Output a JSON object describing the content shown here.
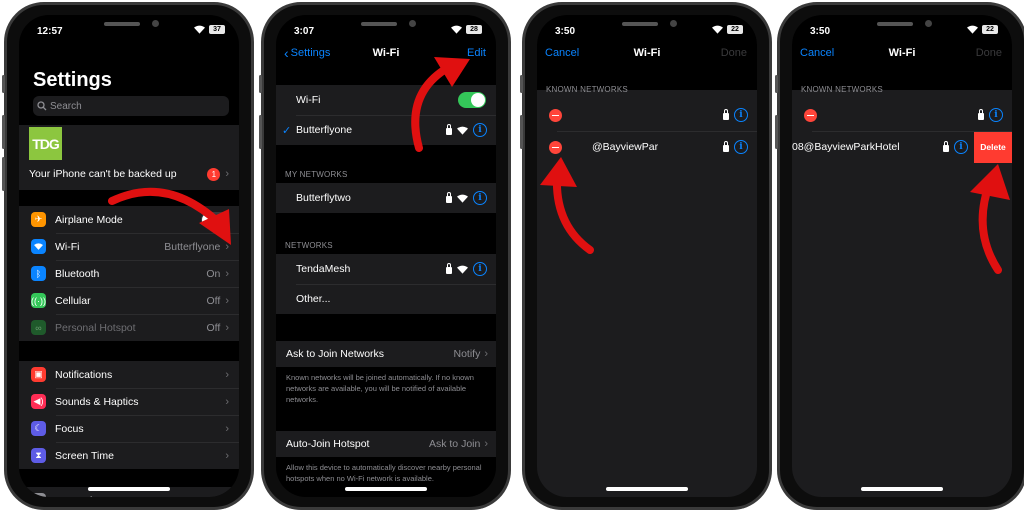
{
  "colors": {
    "accent": "#0a84ff",
    "destructive": "#ff3b30",
    "arrow": "#e01010",
    "toggle_on": "#34c759",
    "brand_tdg": "#8cc63f"
  },
  "phone1": {
    "status": {
      "time": "12:57",
      "battery": "37"
    },
    "title": "Settings",
    "search_placeholder": "Search",
    "profile_logo": "TDG",
    "backup_notice": {
      "label": "Your iPhone can't be backed up",
      "badge": "1"
    },
    "group1": [
      {
        "icon": "airplane-icon",
        "label": "Airplane Mode",
        "type": "toggle",
        "on": false
      },
      {
        "icon": "wifi-icon",
        "label": "Wi-Fi",
        "value": "Butterflyone"
      },
      {
        "icon": "bluetooth-icon",
        "label": "Bluetooth",
        "value": "On"
      },
      {
        "icon": "cellular-icon",
        "label": "Cellular",
        "value": "Off"
      },
      {
        "icon": "hotspot-icon",
        "label": "Personal Hotspot",
        "value": "Off",
        "disabled": true
      }
    ],
    "group2": [
      {
        "icon": "notifications-icon",
        "label": "Notifications"
      },
      {
        "icon": "sounds-icon",
        "label": "Sounds & Haptics"
      },
      {
        "icon": "focus-icon",
        "label": "Focus"
      },
      {
        "icon": "screen-time-icon",
        "label": "Screen Time"
      }
    ],
    "group3": [
      {
        "icon": "gear-icon",
        "label": "General"
      }
    ]
  },
  "phone2": {
    "status": {
      "time": "3:07",
      "battery": "28"
    },
    "nav": {
      "back": "Settings",
      "title": "Wi-Fi",
      "action": "Edit"
    },
    "wifi_toggle": {
      "label": "Wi-Fi",
      "on": true
    },
    "connected": "Butterflyone",
    "my_networks_header": "MY NETWORKS",
    "my_networks": [
      "Butterflytwo"
    ],
    "networks_header": "NETWORKS",
    "networks": [
      "TendaMesh"
    ],
    "other": "Other...",
    "ask_to_join": {
      "label": "Ask to Join Networks",
      "value": "Notify",
      "footer": "Known networks will be joined automatically. If no known networks are available, you will be notified of available networks."
    },
    "auto_join": {
      "label": "Auto-Join Hotspot",
      "value": "Ask to Join",
      "footer": "Allow this device to automatically discover nearby personal hotspots when no Wi-Fi network is available."
    }
  },
  "phone3": {
    "status": {
      "time": "3:50",
      "battery": "22"
    },
    "nav": {
      "cancel": "Cancel",
      "title": "Wi-Fi",
      "done": "Done"
    },
    "header": "KNOWN NETWORKS",
    "networks": [
      "",
      "@BayviewPar"
    ]
  },
  "phone4": {
    "status": {
      "time": "3:50",
      "battery": "22"
    },
    "nav": {
      "cancel": "Cancel",
      "title": "Wi-Fi",
      "done": "Done"
    },
    "header": "KNOWN NETWORKS",
    "networks": [
      "",
      "08@BayviewParkHotel"
    ],
    "delete_label": "Delete"
  }
}
